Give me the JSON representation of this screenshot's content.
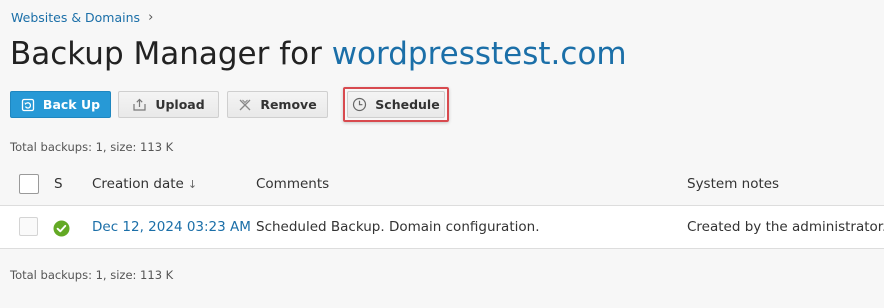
{
  "breadcrumb": {
    "label": "Websites & Domains",
    "separator": "›"
  },
  "title": {
    "prefix": "Backup Manager for ",
    "domain": "wordpresstest.com"
  },
  "toolbar": {
    "backup_label": "Back Up",
    "upload_label": "Upload",
    "remove_label": "Remove",
    "schedule_label": "Schedule"
  },
  "summary": {
    "top": "Total backups: 1, size: 113 K",
    "bottom": "Total backups: 1, size: 113 K"
  },
  "table": {
    "headers": {
      "status": "S",
      "date": "Creation date",
      "sort_arrow": "↓",
      "comments": "Comments",
      "notes": "System notes"
    },
    "rows": [
      {
        "status": "ok",
        "date": "Dec 12, 2024 03:23 AM",
        "comments": "Scheduled Backup. Domain configuration.",
        "notes": "Created by the administrator."
      }
    ]
  },
  "colors": {
    "accent": "#1b6fa8",
    "primary_button": "#2799d6",
    "highlight": "#d84a4f",
    "status_ok": "#63a924"
  },
  "icons": {
    "backup": "backup-icon",
    "upload": "upload-icon",
    "remove": "remove-icon",
    "schedule": "clock-icon",
    "status": "check-circle-icon",
    "breadcrumb_separator": "chevron-right-icon",
    "sort": "sort-arrow-icon"
  }
}
